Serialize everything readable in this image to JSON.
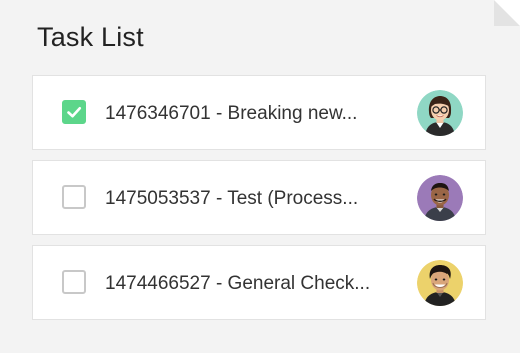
{
  "header": {
    "title": "Task List"
  },
  "tasks": [
    {
      "label": "1476346701 - Breaking new...",
      "checked": true,
      "avatar_icon": "woman-glasses-avatar",
      "avatar_bg": "#8fd7c4"
    },
    {
      "label": "1475053537 - Test (Process...",
      "checked": false,
      "avatar_icon": "man-smiling-avatar",
      "avatar_bg": "#9b7ab8"
    },
    {
      "label": "1474466527 - General Check...",
      "checked": false,
      "avatar_icon": "man-dark-hair-avatar",
      "avatar_bg": "#ecd26b"
    }
  ],
  "colors": {
    "check_green": "#5cd68a",
    "card_border": "#e2e2e2",
    "background": "#f3f3f3"
  }
}
